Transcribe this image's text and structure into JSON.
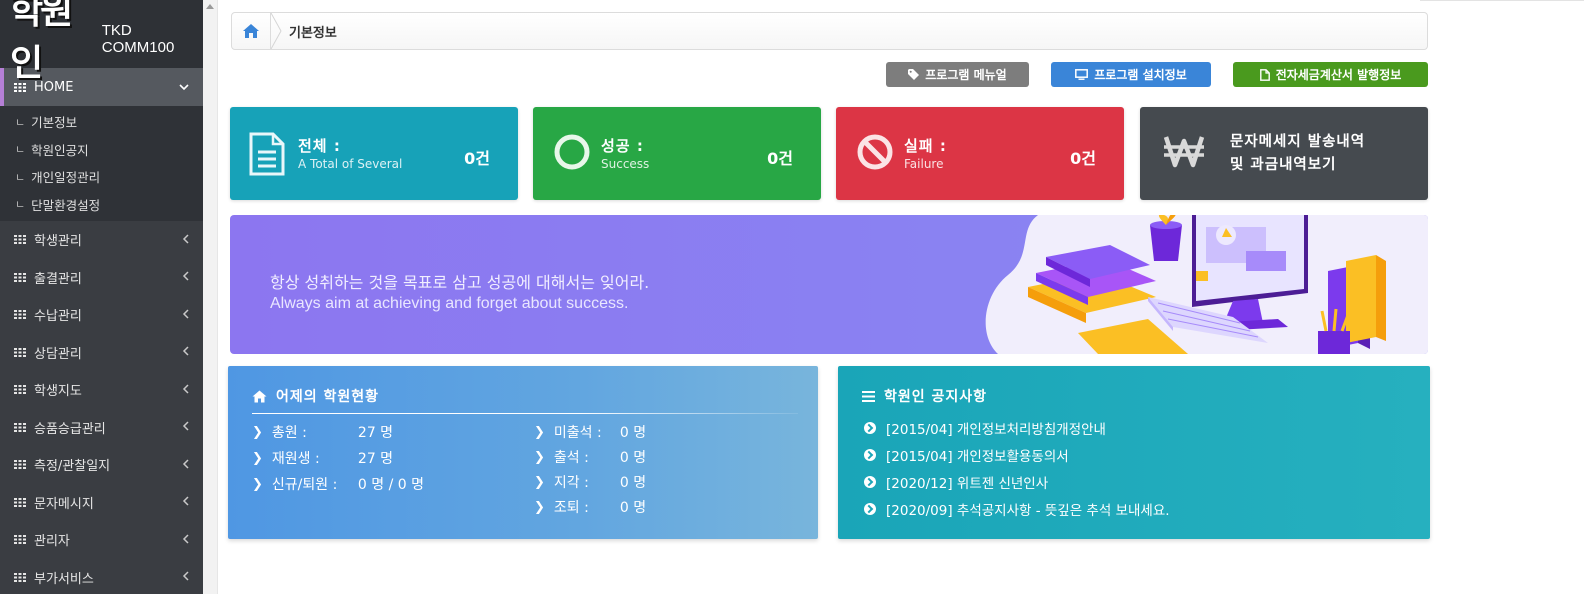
{
  "logo": {
    "mark": "학원인",
    "text": "TKD COMM100"
  },
  "sidebar": {
    "home_label": "HOME",
    "sub_items": [
      "기본정보",
      "학원인공지",
      "개인일정관리",
      "단말환경설정"
    ],
    "items": [
      "학생관리",
      "출결관리",
      "수납관리",
      "상담관리",
      "학생지도",
      "승품승급관리",
      "측정/관찰일지",
      "문자메시지",
      "관리자",
      "부가서비스"
    ]
  },
  "breadcrumb": {
    "current": "기본정보"
  },
  "buttons": {
    "manual": "프로그램 메뉴얼",
    "install": "프로그램 설치정보",
    "tax": "전자세금계산서 발행정보"
  },
  "cards": {
    "total": {
      "title": "전체 :",
      "subtitle": "A Total of Several",
      "count": "0건"
    },
    "success": {
      "title": "성공 :",
      "subtitle": "Success",
      "count": "0건"
    },
    "fail": {
      "title": "실패 :",
      "subtitle": "Failure",
      "count": "0건"
    },
    "sms": {
      "line1": "문자메세지 발송내역",
      "line2": "및 과금내역보기"
    }
  },
  "banner": {
    "korean": "항상 성취하는 것을 목표로 삼고 성공에 대해서는 잊어라.",
    "english": "Always aim at achieving and forget about success."
  },
  "stats_panel": {
    "title": "어제의 학원현황",
    "left": [
      {
        "label": "총원 :",
        "value": "27 명"
      },
      {
        "label": "재원생 :",
        "value": "27 명"
      },
      {
        "label": "신규/퇴원 :",
        "value": "0 명 / 0 명"
      }
    ],
    "right": [
      {
        "label": "미출석 :",
        "value": "0 명"
      },
      {
        "label": "출석 :",
        "value": "0 명"
      },
      {
        "label": "지각 :",
        "value": "0 명"
      },
      {
        "label": "조퇴 :",
        "value": "0 명"
      }
    ]
  },
  "notice_panel": {
    "title": "학원인 공지사항",
    "items": [
      "[2015/04] 개인정보처리방침개정안내",
      "[2015/04] 개인정보활용동의서",
      "[2020/12] 위트젠 신년인사",
      "[2020/09] 추석공지사항 - 뜻깊은 추석 보내세요."
    ]
  },
  "colors": {
    "sidebar_bg": "#3a3d42",
    "active_accent": "#b57fd6",
    "total_card": "#17a2b8",
    "success_card": "#28a745",
    "fail_card": "#dc3545",
    "sms_card": "#454a4f",
    "banner": "#8c76f0"
  }
}
